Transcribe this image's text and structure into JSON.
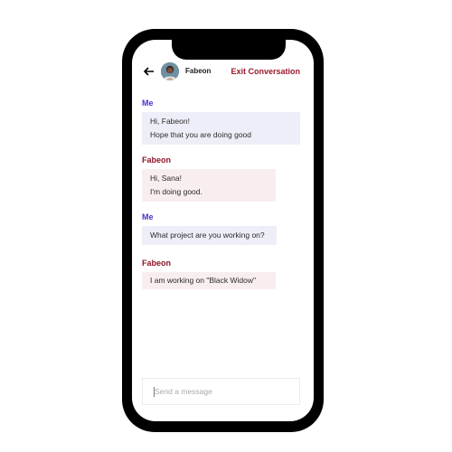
{
  "header": {
    "contact_name": "Fabeon",
    "exit_label": "Exit Conversation",
    "back_icon": "arrow-left-icon"
  },
  "messages": [
    {
      "sender": "Me",
      "lines": [
        "Hi, Fabeon!",
        "Hope that you are doing good"
      ]
    },
    {
      "sender": "Fabeon",
      "lines": [
        "Hi, Sana!",
        "I'm doing good."
      ]
    },
    {
      "sender": "Me",
      "lines": [
        "What project are you working on?"
      ]
    },
    {
      "sender": "Fabeon",
      "lines": [
        "I am working on \"Black Widow\""
      ]
    }
  ],
  "composer": {
    "placeholder": "Send a message",
    "value": ""
  },
  "colors": {
    "me_sender": "#4b2fd0",
    "other_sender": "#8e1428",
    "exit": "#9b1a2c",
    "me_bubble": "#eeeef8",
    "other_bubble": "#f9eeee"
  }
}
